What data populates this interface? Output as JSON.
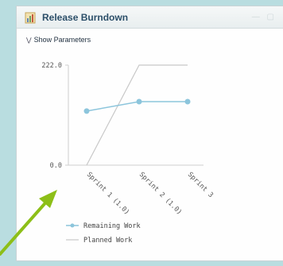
{
  "window": {
    "title": "Release Burndown",
    "controls_icon": "window-controls-icon"
  },
  "params": {
    "toggle_icon": "double-chevron-down-icon",
    "label": "Show Parameters"
  },
  "chart_data": {
    "type": "line",
    "categories": [
      "Sprint 1 (1.0)",
      "Sprint 2 (1.0)",
      "Sprint 3"
    ],
    "y_ticks": [
      "222.0",
      "0.0"
    ],
    "ylim": [
      0,
      222
    ],
    "series": [
      {
        "name": "Remaining Work",
        "values": [
          120,
          141,
          141
        ],
        "color": "#8cc5dc",
        "markers": true
      },
      {
        "name": "Planned Work",
        "values": [
          null,
          222,
          222
        ],
        "color": "#c8c8c8",
        "markers": false,
        "start_value": 0
      }
    ],
    "legend": "bottom-left",
    "grid": false
  },
  "annotation": {
    "arrow_color": "#8dbf18",
    "icon": "pointer-arrow-icon"
  }
}
